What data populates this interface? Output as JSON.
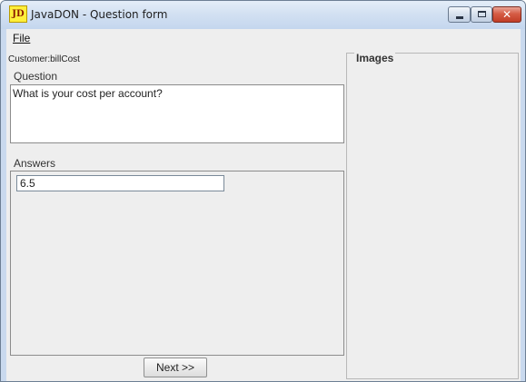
{
  "window": {
    "app_icon_text": "JD",
    "title": "JavaDON - Question form",
    "controls": {
      "minimize_icon": "minimize-icon",
      "maximize_icon": "maximize-icon",
      "close_icon": "close-icon",
      "close_glyph": "✕"
    },
    "colors": {
      "titlebar": "#d3e1f2",
      "close_button": "#d55c45",
      "app_icon": "#ffef3a"
    }
  },
  "menubar": {
    "items": [
      {
        "label": "File"
      }
    ]
  },
  "form": {
    "customer_label": "Customer:billCost",
    "question_label": "Question",
    "question_text": "What is your cost per account?",
    "answers_label": "Answers",
    "answer_value": "6.5",
    "next_label": "Next >>"
  },
  "images_panel": {
    "title": "Images"
  }
}
